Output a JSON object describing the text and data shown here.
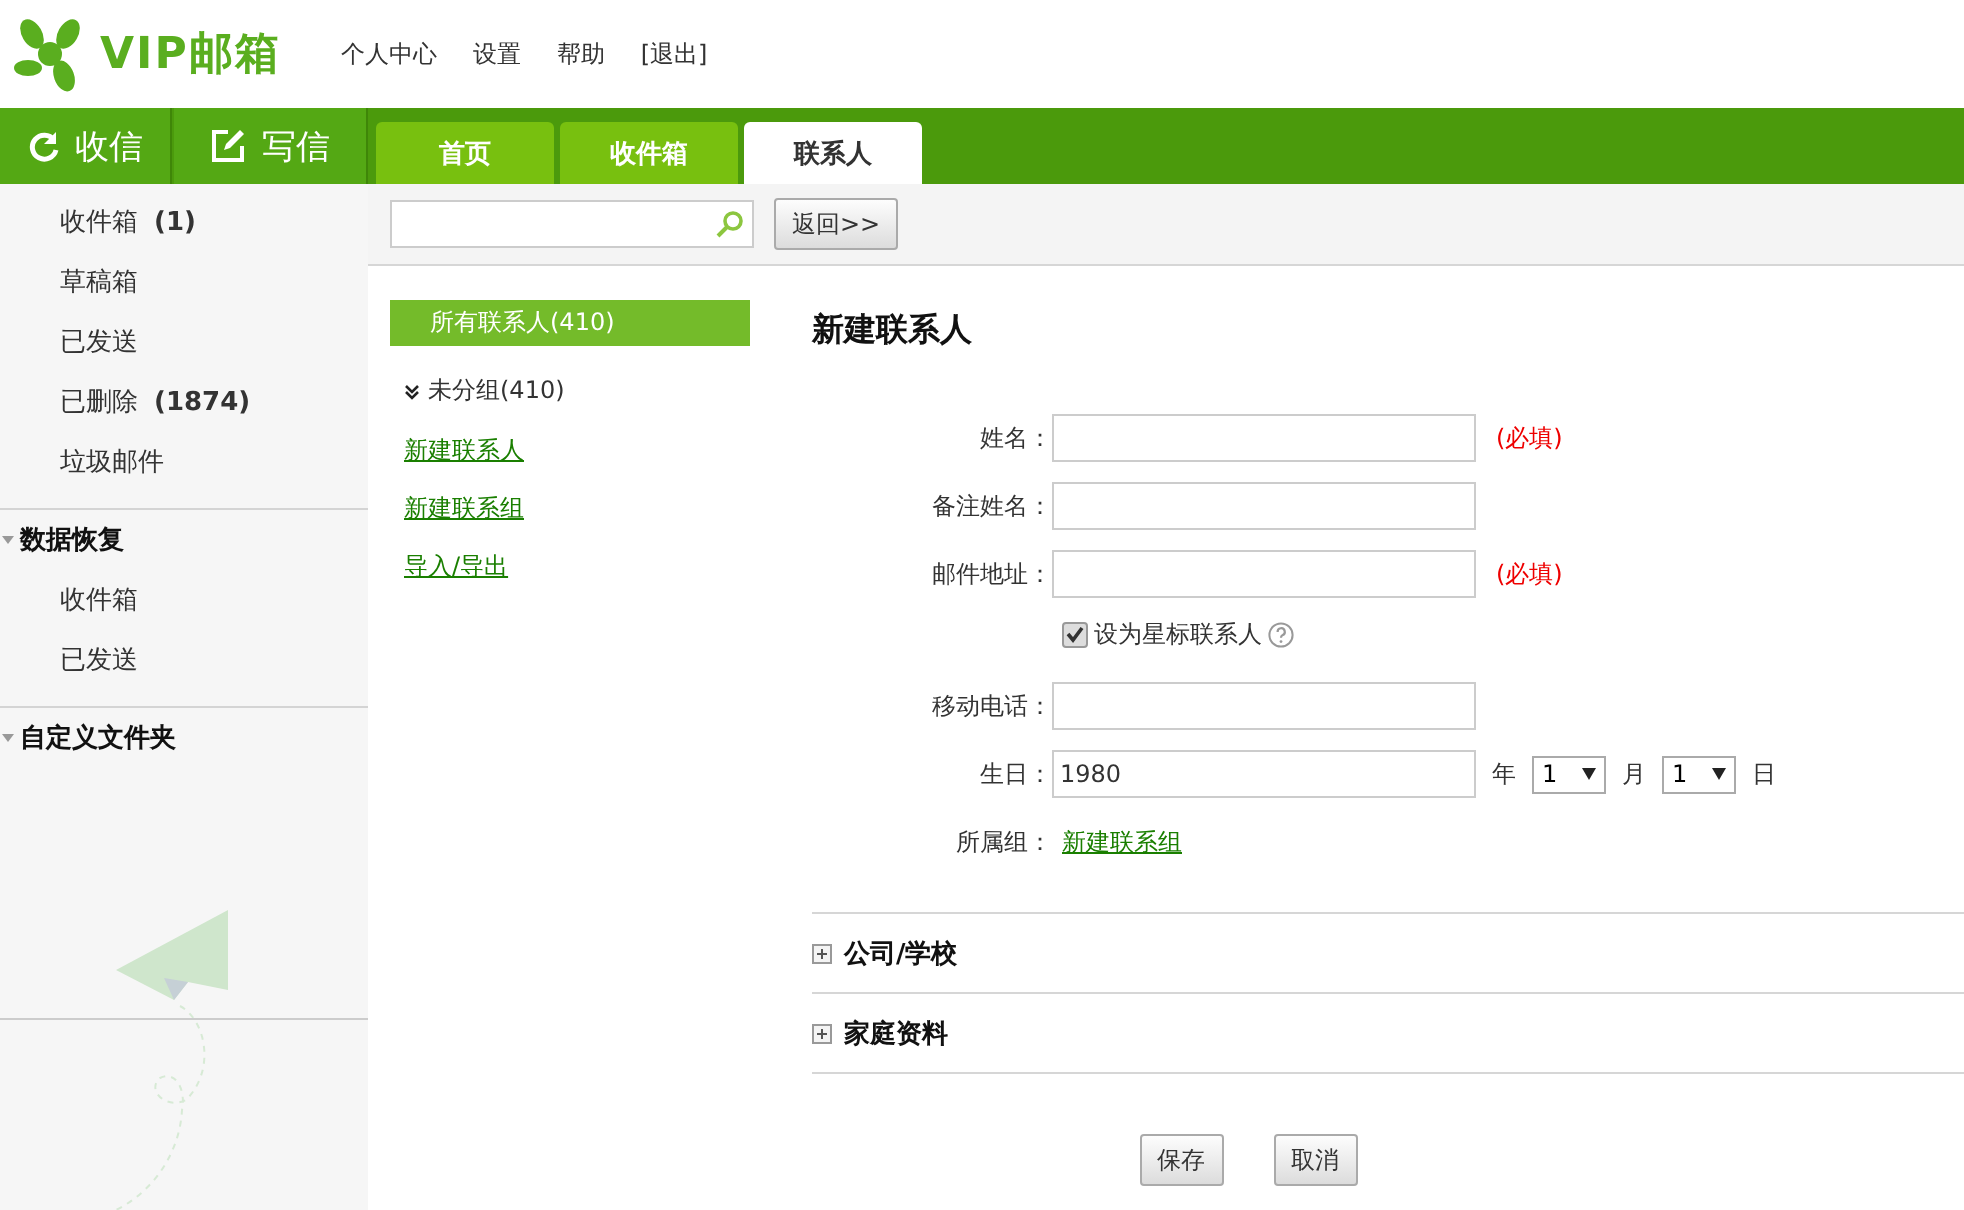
{
  "header": {
    "logo": "VIP邮箱",
    "links": [
      "个人中心",
      "设置",
      "帮助",
      "[退出]"
    ]
  },
  "actions": [
    {
      "label": "收信",
      "kind": "refresh"
    },
    {
      "label": "写信",
      "kind": "compose"
    }
  ],
  "tabs": [
    {
      "label": "首页",
      "selected": false
    },
    {
      "label": "收件箱",
      "selected": false
    },
    {
      "label": "联系人",
      "selected": true
    }
  ],
  "sidebar": {
    "folders": [
      {
        "name": "收件箱",
        "count": "(1)"
      },
      {
        "name": "草稿箱"
      },
      {
        "name": "已发送"
      },
      {
        "name": "已删除",
        "count": "(1874)"
      },
      {
        "name": "垃圾邮件"
      }
    ],
    "sections": [
      {
        "title": "数据恢复",
        "items": [
          "收件箱",
          "已发送"
        ]
      },
      {
        "title": "自定义文件夹"
      }
    ]
  },
  "toolbar": {
    "back_button": "返回>>"
  },
  "contacts": {
    "all": {
      "label": "所有联系人(410)",
      "selected": true
    },
    "group": {
      "label": "未分组(410)",
      "expanded": true
    },
    "links": [
      "新建联系人",
      "新建联系组",
      "导入/导出"
    ]
  },
  "form": {
    "title": "新建联系人",
    "fields": [
      {
        "kind": "text",
        "label": "姓名：",
        "note": "(必填)"
      },
      {
        "kind": "text",
        "label": "备注姓名："
      },
      {
        "kind": "text",
        "label": "邮件地址：",
        "note": "(必填)"
      },
      {
        "kind": "checkbox",
        "label": "设为星标联系人",
        "checked": true
      },
      {
        "kind": "text",
        "label": "移动电话："
      },
      {
        "kind": "date",
        "label": "生日：",
        "value": "1980",
        "year_unit": "年",
        "month": "1",
        "month_unit": "月",
        "day": "1",
        "day_unit": "日"
      },
      {
        "kind": "link",
        "label": "所属组：",
        "link": "新建联系组"
      }
    ],
    "sections": [
      "公司/学校",
      "家庭资料"
    ],
    "buttons": [
      "保存",
      "取消"
    ]
  }
}
